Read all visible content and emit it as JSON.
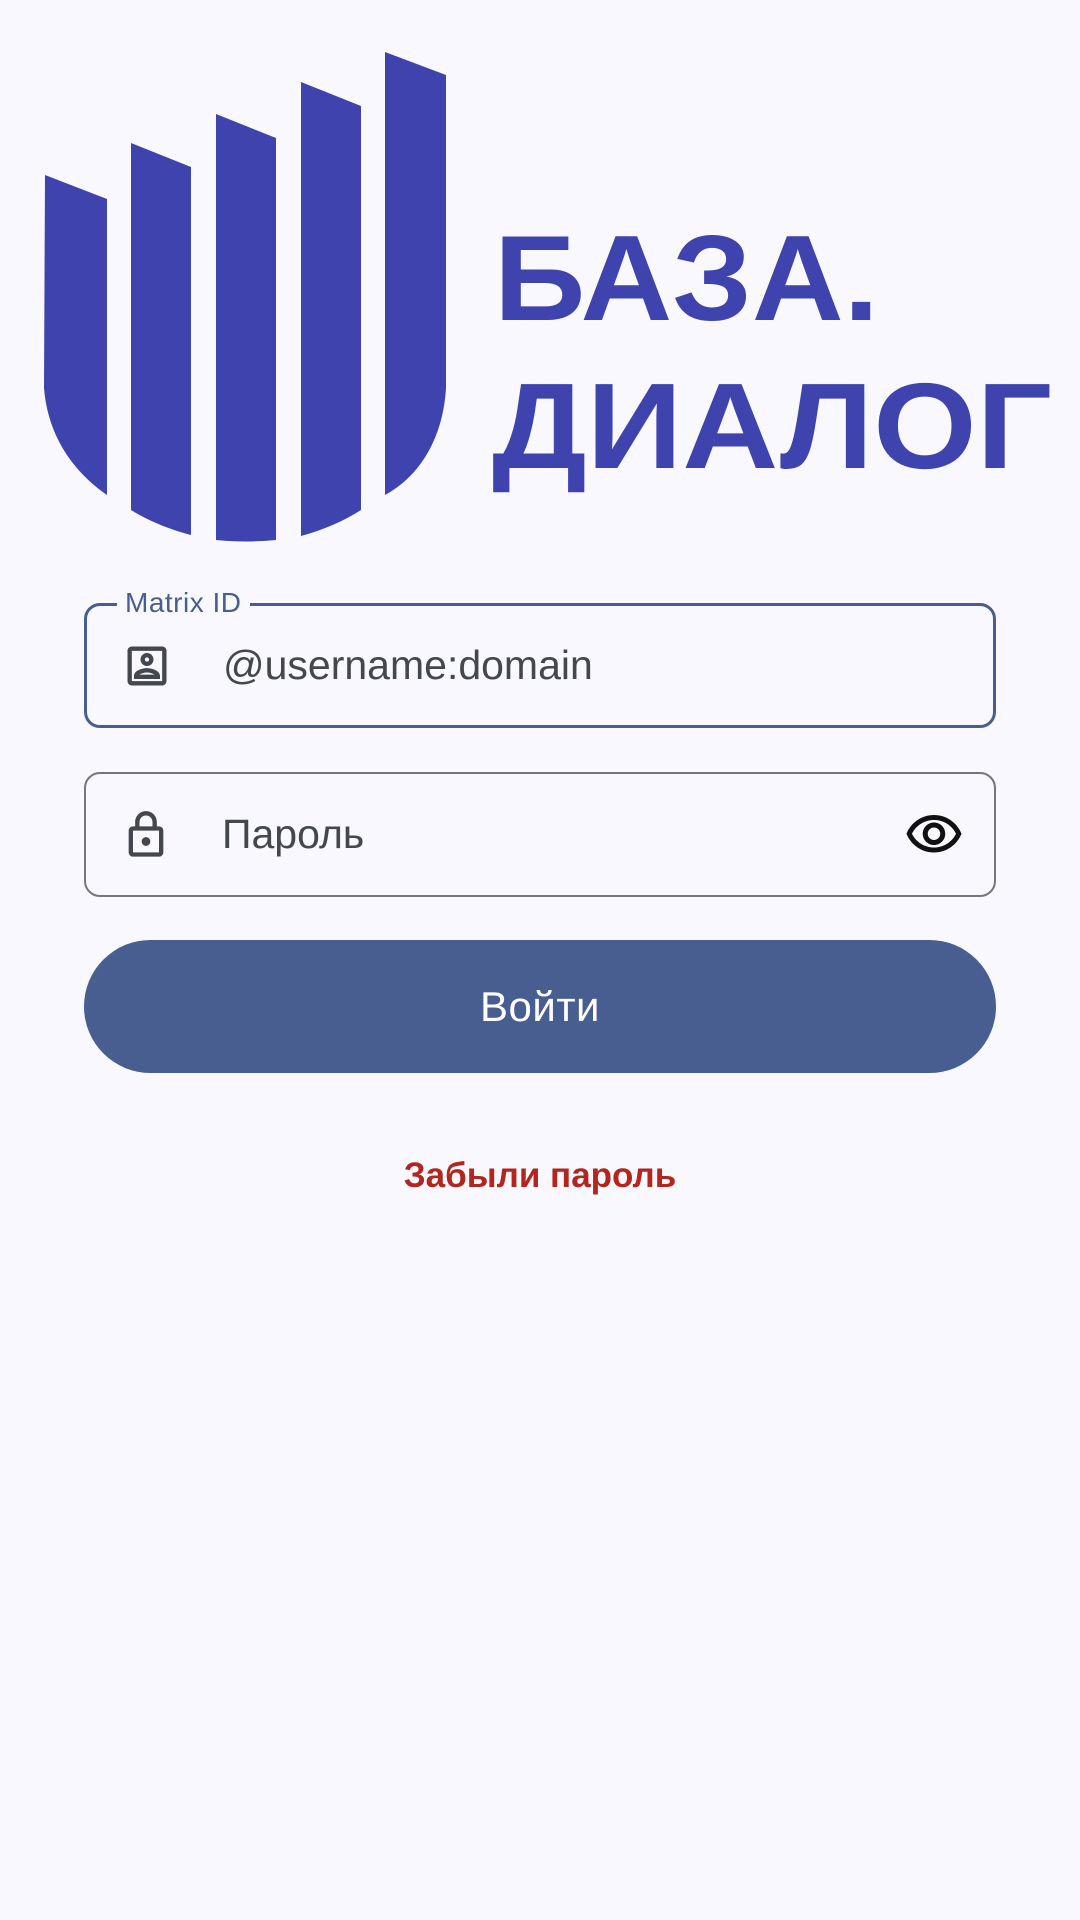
{
  "colors": {
    "background": "#f8f8fe",
    "brand": "#3f43ad",
    "primary": "#485e91",
    "outline": "#74767e",
    "on_surface_variant": "#44474e",
    "error": "#b3261e",
    "on_primary": "#ffffff"
  },
  "logo": {
    "line1": "БАЗА.",
    "line2": "ДИАЛОГ"
  },
  "matrix_field": {
    "label": "Matrix ID",
    "placeholder": "@username:domain",
    "icon": "account-box-icon"
  },
  "password_field": {
    "placeholder": "Пароль",
    "icon": "lock-icon",
    "toggle_icon": "eye-icon"
  },
  "login_button": {
    "label": "Войти"
  },
  "forgot_password": {
    "label": "Забыли пароль"
  }
}
